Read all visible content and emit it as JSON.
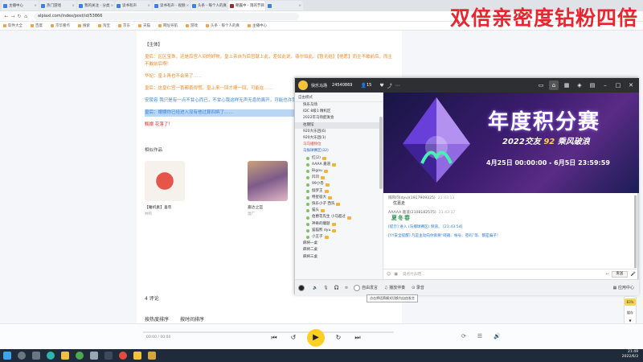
{
  "browser": {
    "tabs": [
      {
        "label": "主播中心",
        "active": false
      },
      {
        "label": "热门游戏",
        "active": false
      },
      {
        "label": "我的关注 - 分类",
        "active": false
      },
      {
        "label": "读书有声",
        "active": false
      },
      {
        "label": "读书有声 - 视频",
        "active": false
      },
      {
        "label": "头条 - 每个人的真",
        "active": false
      },
      {
        "label": "朝露中 - 雨的节目",
        "active": true
      },
      {
        "label": "",
        "active": false
      }
    ],
    "url": "alpiaxl.com/index/post/id/53866",
    "bookmarks": [
      "软件大全",
      "百度",
      "京华看点",
      "搜索",
      "淘宝",
      "京东",
      "天猫",
      "网址导航",
      "游戏",
      "头条 - 每个人的真",
      "主播中心"
    ]
  },
  "overlay_title": "双倍亲密度钻粉四倍",
  "article": {
    "lines": [
      {
        "text": "【主体】",
        "style": "plain"
      },
      {
        "text": "皇后：区区宝珠，还是后宫人间的好物，皇上亲自为后宫献上此，差如此说，翡尔如此。【暂无结】【他愿】而主不敢前后，而主不敢前后啊！",
        "style": "orange"
      },
      {
        "text": "华妃：皇上再也不会来了……",
        "style": "orange"
      },
      {
        "text": "皇后：这皇仁宫一喜都喜得慌。皇上来一回才睡一回，可能在……",
        "style": "orange"
      },
      {
        "text": "安陵容 我只是有一点不甘心而已，不甘心我这样无声无息的离开，可能也许我的心早已不甘心，而我……",
        "style": "blue"
      },
      {
        "text": "皇后：嬛嬛你已经进入没有他过算四嫔了……",
        "style": "highlight"
      },
      {
        "text": "甄嬛 花落了！",
        "style": "red"
      }
    ],
    "related_title": "相似作品",
    "works": [
      {
        "title": "【睡机素】喜年",
        "author": "共鸣"
      },
      {
        "title": "嘉达之宫",
        "author": "温广"
      }
    ],
    "comments": "4 评论",
    "sort_hot": "按热度排序",
    "sort_time": "按时间排序"
  },
  "yy": {
    "header": {
      "name": "快乐马场",
      "id": "24540869",
      "members": "15"
    },
    "mode_label": "自由模式",
    "channels": [
      {
        "label": "快乐马场",
        "cls": "ind2"
      },
      {
        "label": "IDC 8级1 精机区",
        "cls": "ind2"
      },
      {
        "label": "2022年马场配发会",
        "cls": "ind2"
      },
      {
        "label": "往期馆",
        "cls": "ind2 sel"
      },
      {
        "label": "920大乐团(6)",
        "cls": "ind2"
      },
      {
        "label": "920大乐团(1)",
        "cls": "ind2"
      },
      {
        "label": "马马播频位",
        "cls": "ind2 red"
      },
      {
        "label": "马振球赛区(32)",
        "cls": "ind2 blue"
      },
      {
        "label": "红(2)",
        "cls": "ind"
      },
      {
        "label": "AAAA 嘉道",
        "cls": "ind"
      },
      {
        "label": "Bigou",
        "cls": "ind"
      },
      {
        "label": "凹凹",
        "cls": "ind"
      },
      {
        "label": "99小卷",
        "cls": "ind"
      },
      {
        "label": "伽罗王",
        "cls": "ind"
      },
      {
        "label": "特星宿大",
        "cls": "ind"
      },
      {
        "label": "快乐小子 西洗",
        "cls": "ind"
      },
      {
        "label": "猫头",
        "cls": "ind"
      },
      {
        "label": "伯爵花先生 小马超过",
        "cls": "ind"
      },
      {
        "label": "神奇的罐题",
        "cls": "ind"
      },
      {
        "label": "猫猫熊 dyu",
        "cls": "ind"
      },
      {
        "label": "小王子",
        "cls": "ind"
      },
      {
        "label": "麻将一桌",
        "cls": "ind2"
      },
      {
        "label": "麻将二桌",
        "cls": "ind2"
      },
      {
        "label": "麻将三桌",
        "cls": "ind2"
      }
    ],
    "banner": {
      "title": "年度积分赛",
      "sub_year": "2022",
      "sub_mid": "交友",
      "sub_num": "92",
      "sub_end": "乘风破浪",
      "date": "4月25日 00:00:00 - 6月5日 23:59:59"
    },
    "chat": [
      {
        "name": "隔帘问(dyu)(1917909325)",
        "time": "21:43:13",
        "content": "优嘉走",
        "kind": "text"
      },
      {
        "name": "AAAAA 嘉道(2108182575)",
        "time": "21:43:37",
        "content": "夏冬春",
        "kind": "green"
      },
      {
        "name": "",
        "time": "",
        "content": "[提示] 进入 (马播球赛区) 频道。 [21:43:54]",
        "kind": "sys"
      },
      {
        "name": "",
        "time": "",
        "content": "[YY安全提醒] 凡是主动向你索要“邮箱、帐号、密码”等、都是骗子！",
        "kind": "sys"
      }
    ],
    "input_placeholder": "说点什么吧...",
    "send_label": "发送",
    "apps_label": "应用中心",
    "bottom": {
      "mic": "自由发言",
      "music": "播放伴奏",
      "voice": "录音"
    },
    "tooltip": "点击将话筒模式切换为自由发言"
  },
  "side_widget": {
    "percent": "83%",
    "label": "缓存"
  },
  "player": {
    "time": "00:00 / 00:00"
  },
  "taskbar": {
    "time": "21:49",
    "date": "2022/6/3"
  }
}
